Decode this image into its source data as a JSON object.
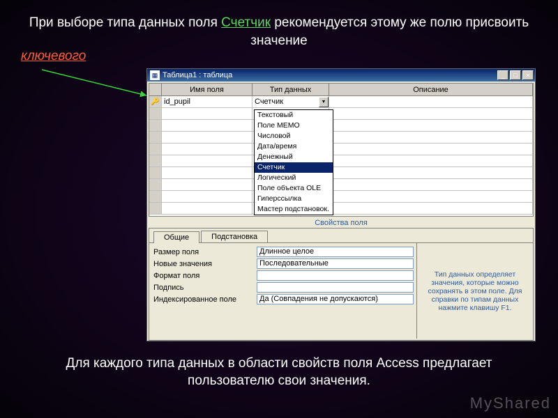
{
  "slide": {
    "top_text_a": "При выборе типа данных поля ",
    "top_text_highlight": "Счетчик",
    "top_text_b": " рекомендуется этому же полю присвоить значение",
    "key_word": "ключевого",
    "bottom_text": "Для каждого типа данных в области свойств поля Access предлагает пользователю свои значения.",
    "watermark": "MyShared"
  },
  "window": {
    "title": "Таблица1 : таблица",
    "columns": {
      "name": "Имя поля",
      "type": "Тип данных",
      "desc": "Описание"
    },
    "row1": {
      "field_name": "id_pupil",
      "field_type": "Счетчик"
    },
    "dropdown_items": [
      "Текстовый",
      "Поле МЕМО",
      "Числовой",
      "Дата/время",
      "Денежный",
      "Счетчик",
      "Логический",
      "Поле объекта OLE",
      "Гиперссылка",
      "Мастер подстановок."
    ],
    "dropdown_selected_index": 5,
    "props_section_label": "Свойства поля",
    "tabs": {
      "general": "Общие",
      "lookup": "Подстановка"
    },
    "props": [
      {
        "label": "Размер поля",
        "value": "Длинное целое"
      },
      {
        "label": "Новые значения",
        "value": "Последовательные"
      },
      {
        "label": "Формат поля",
        "value": ""
      },
      {
        "label": "Подпись",
        "value": ""
      },
      {
        "label": "Индексированное поле",
        "value": "Да (Совпадения не допускаются)"
      }
    ],
    "help_text": "Тип данных определяет значения, которые можно сохранять в этом поле. Для справки по типам данных нажмите клавишу F1."
  }
}
